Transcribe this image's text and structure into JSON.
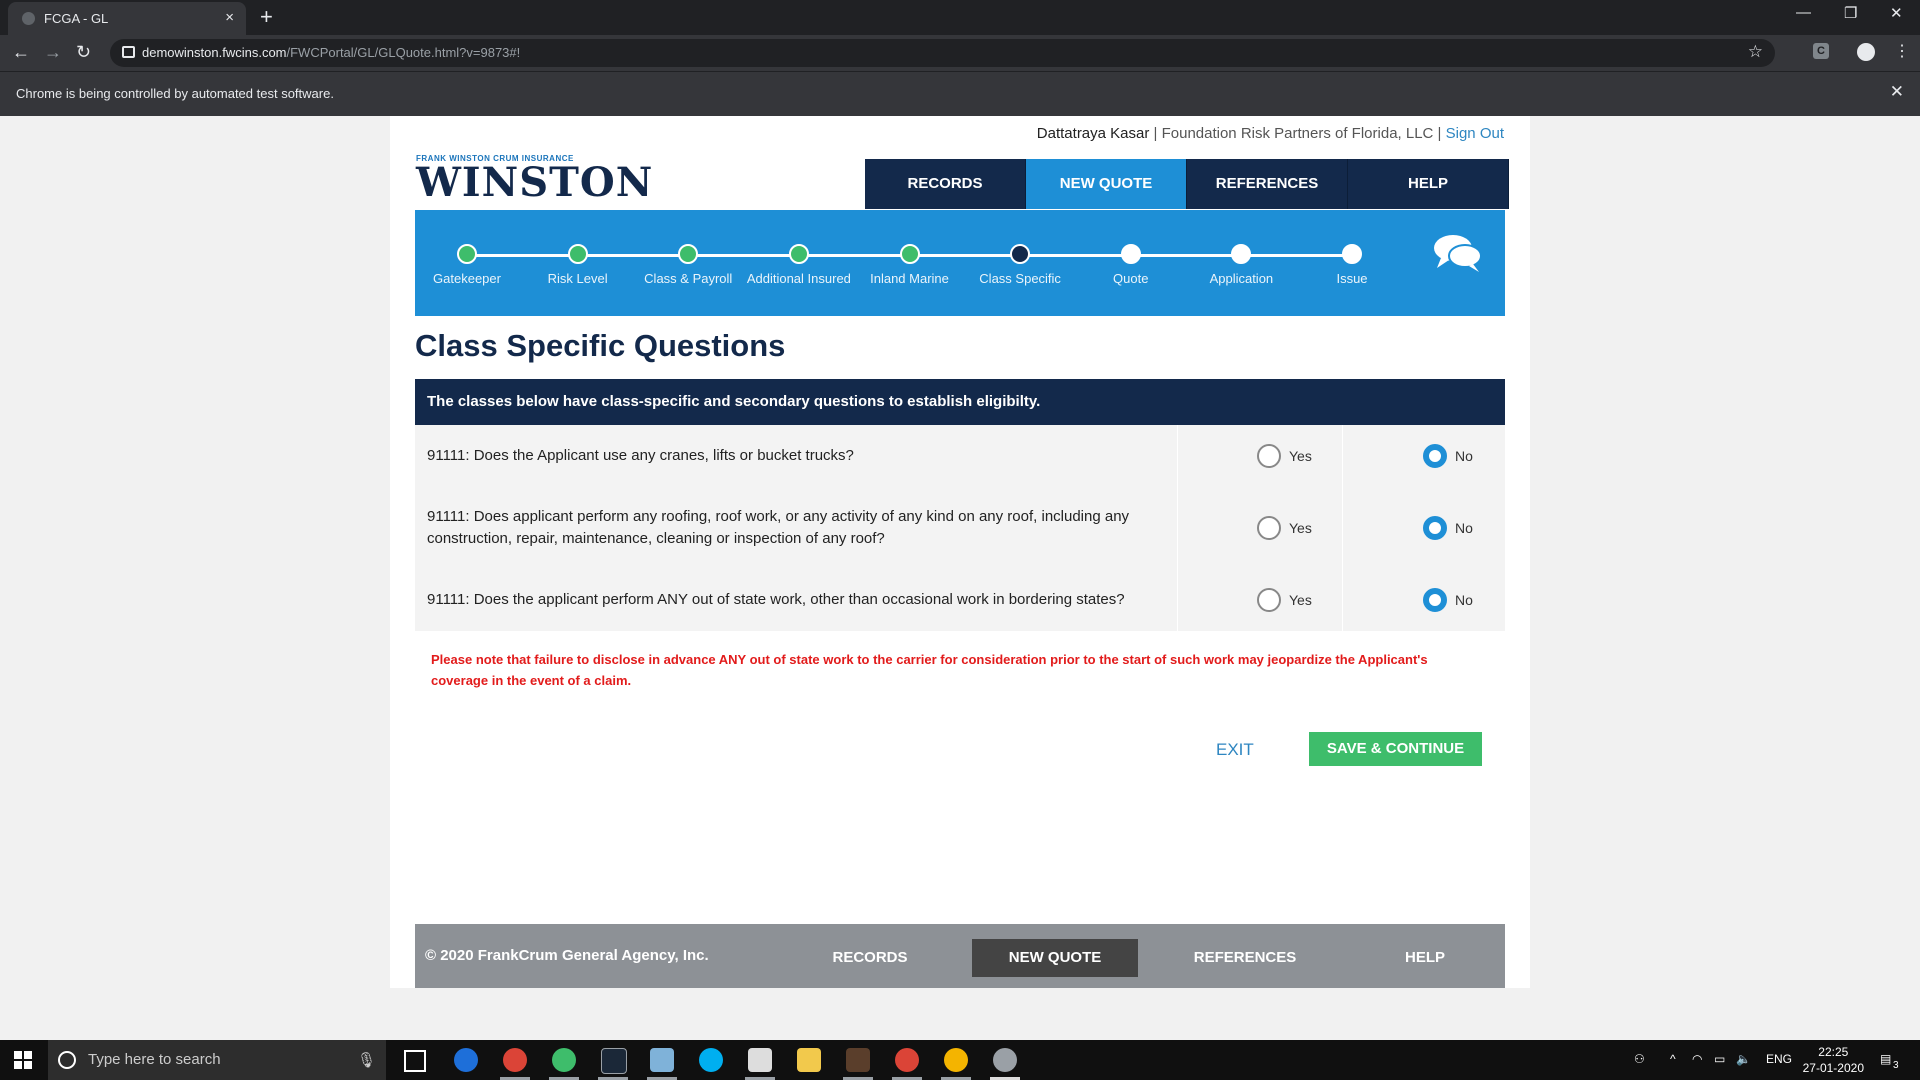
{
  "browser": {
    "tab_title": "FCGA - GL",
    "tab_close": "×",
    "new_tab": "+",
    "url_host": "demowinston.fwcins.com",
    "url_path": "/FWCPortal/GL/GLQuote.html?v=9873#!",
    "infobar_message": "Chrome is being controlled by automated test software.",
    "infobar_close": "✕",
    "extension_label": "C"
  },
  "header": {
    "user_name": "Dattatraya Kasar",
    "separator1": " | ",
    "agency": "Foundation Risk Partners of Florida, LLC",
    "separator2": " | ",
    "sign_out": "Sign Out",
    "logo_tagline": "FRANK WINSTON CRUM INSURANCE",
    "logo_word": "WINSTON",
    "nav": [
      "RECORDS",
      "NEW QUOTE",
      "REFERENCES",
      "HELP"
    ],
    "active_nav": "NEW QUOTE"
  },
  "progress": {
    "steps": [
      {
        "label": "Gatekeeper",
        "state": "done"
      },
      {
        "label": "Risk Level",
        "state": "done"
      },
      {
        "label": "Class & Payroll",
        "state": "done"
      },
      {
        "label": "Additional Insured",
        "state": "done"
      },
      {
        "label": "Inland Marine",
        "state": "done"
      },
      {
        "label": "Class Specific",
        "state": "current"
      },
      {
        "label": "Quote",
        "state": "todo"
      },
      {
        "label": "Application",
        "state": "todo"
      },
      {
        "label": "Issue",
        "state": "todo"
      }
    ]
  },
  "main": {
    "title": "Class Specific Questions",
    "intro": "The classes below have class-specific and secondary questions to establish eligibilty.",
    "yes_label": "Yes",
    "no_label": "No",
    "questions": [
      {
        "text": "91111: Does the Applicant use any cranes, lifts or bucket trucks?",
        "answer": "No"
      },
      {
        "text": "91111: Does applicant perform any roofing, roof work, or any activity of any kind on any roof, including any construction, repair, maintenance, cleaning or inspection of any roof?",
        "answer": "No"
      },
      {
        "text": "91111: Does the applicant perform ANY out of state work, other than occasional work in bordering states?",
        "answer": "No"
      }
    ],
    "warning": "Please note that failure to disclose in advance ANY out of state work to the carrier for consideration prior to the start of such work may jeopardize the Applicant's coverage in the event of a claim.",
    "exit_label": "EXIT",
    "save_label": "SAVE & CONTINUE"
  },
  "footer": {
    "copyright": "© 2020 FrankCrum General Agency, Inc.",
    "nav": [
      "RECORDS",
      "NEW QUOTE",
      "REFERENCES",
      "HELP"
    ],
    "active_nav": "NEW QUOTE"
  },
  "taskbar": {
    "search_placeholder": "Type here to search",
    "language": "ENG",
    "time": "22:25",
    "date": "27-01-2020",
    "notification_count": "3"
  },
  "colors": {
    "navy": "#13294b",
    "blue": "#1e8fd6",
    "green": "#3ebd6b",
    "warning_red": "#e21b1b"
  }
}
